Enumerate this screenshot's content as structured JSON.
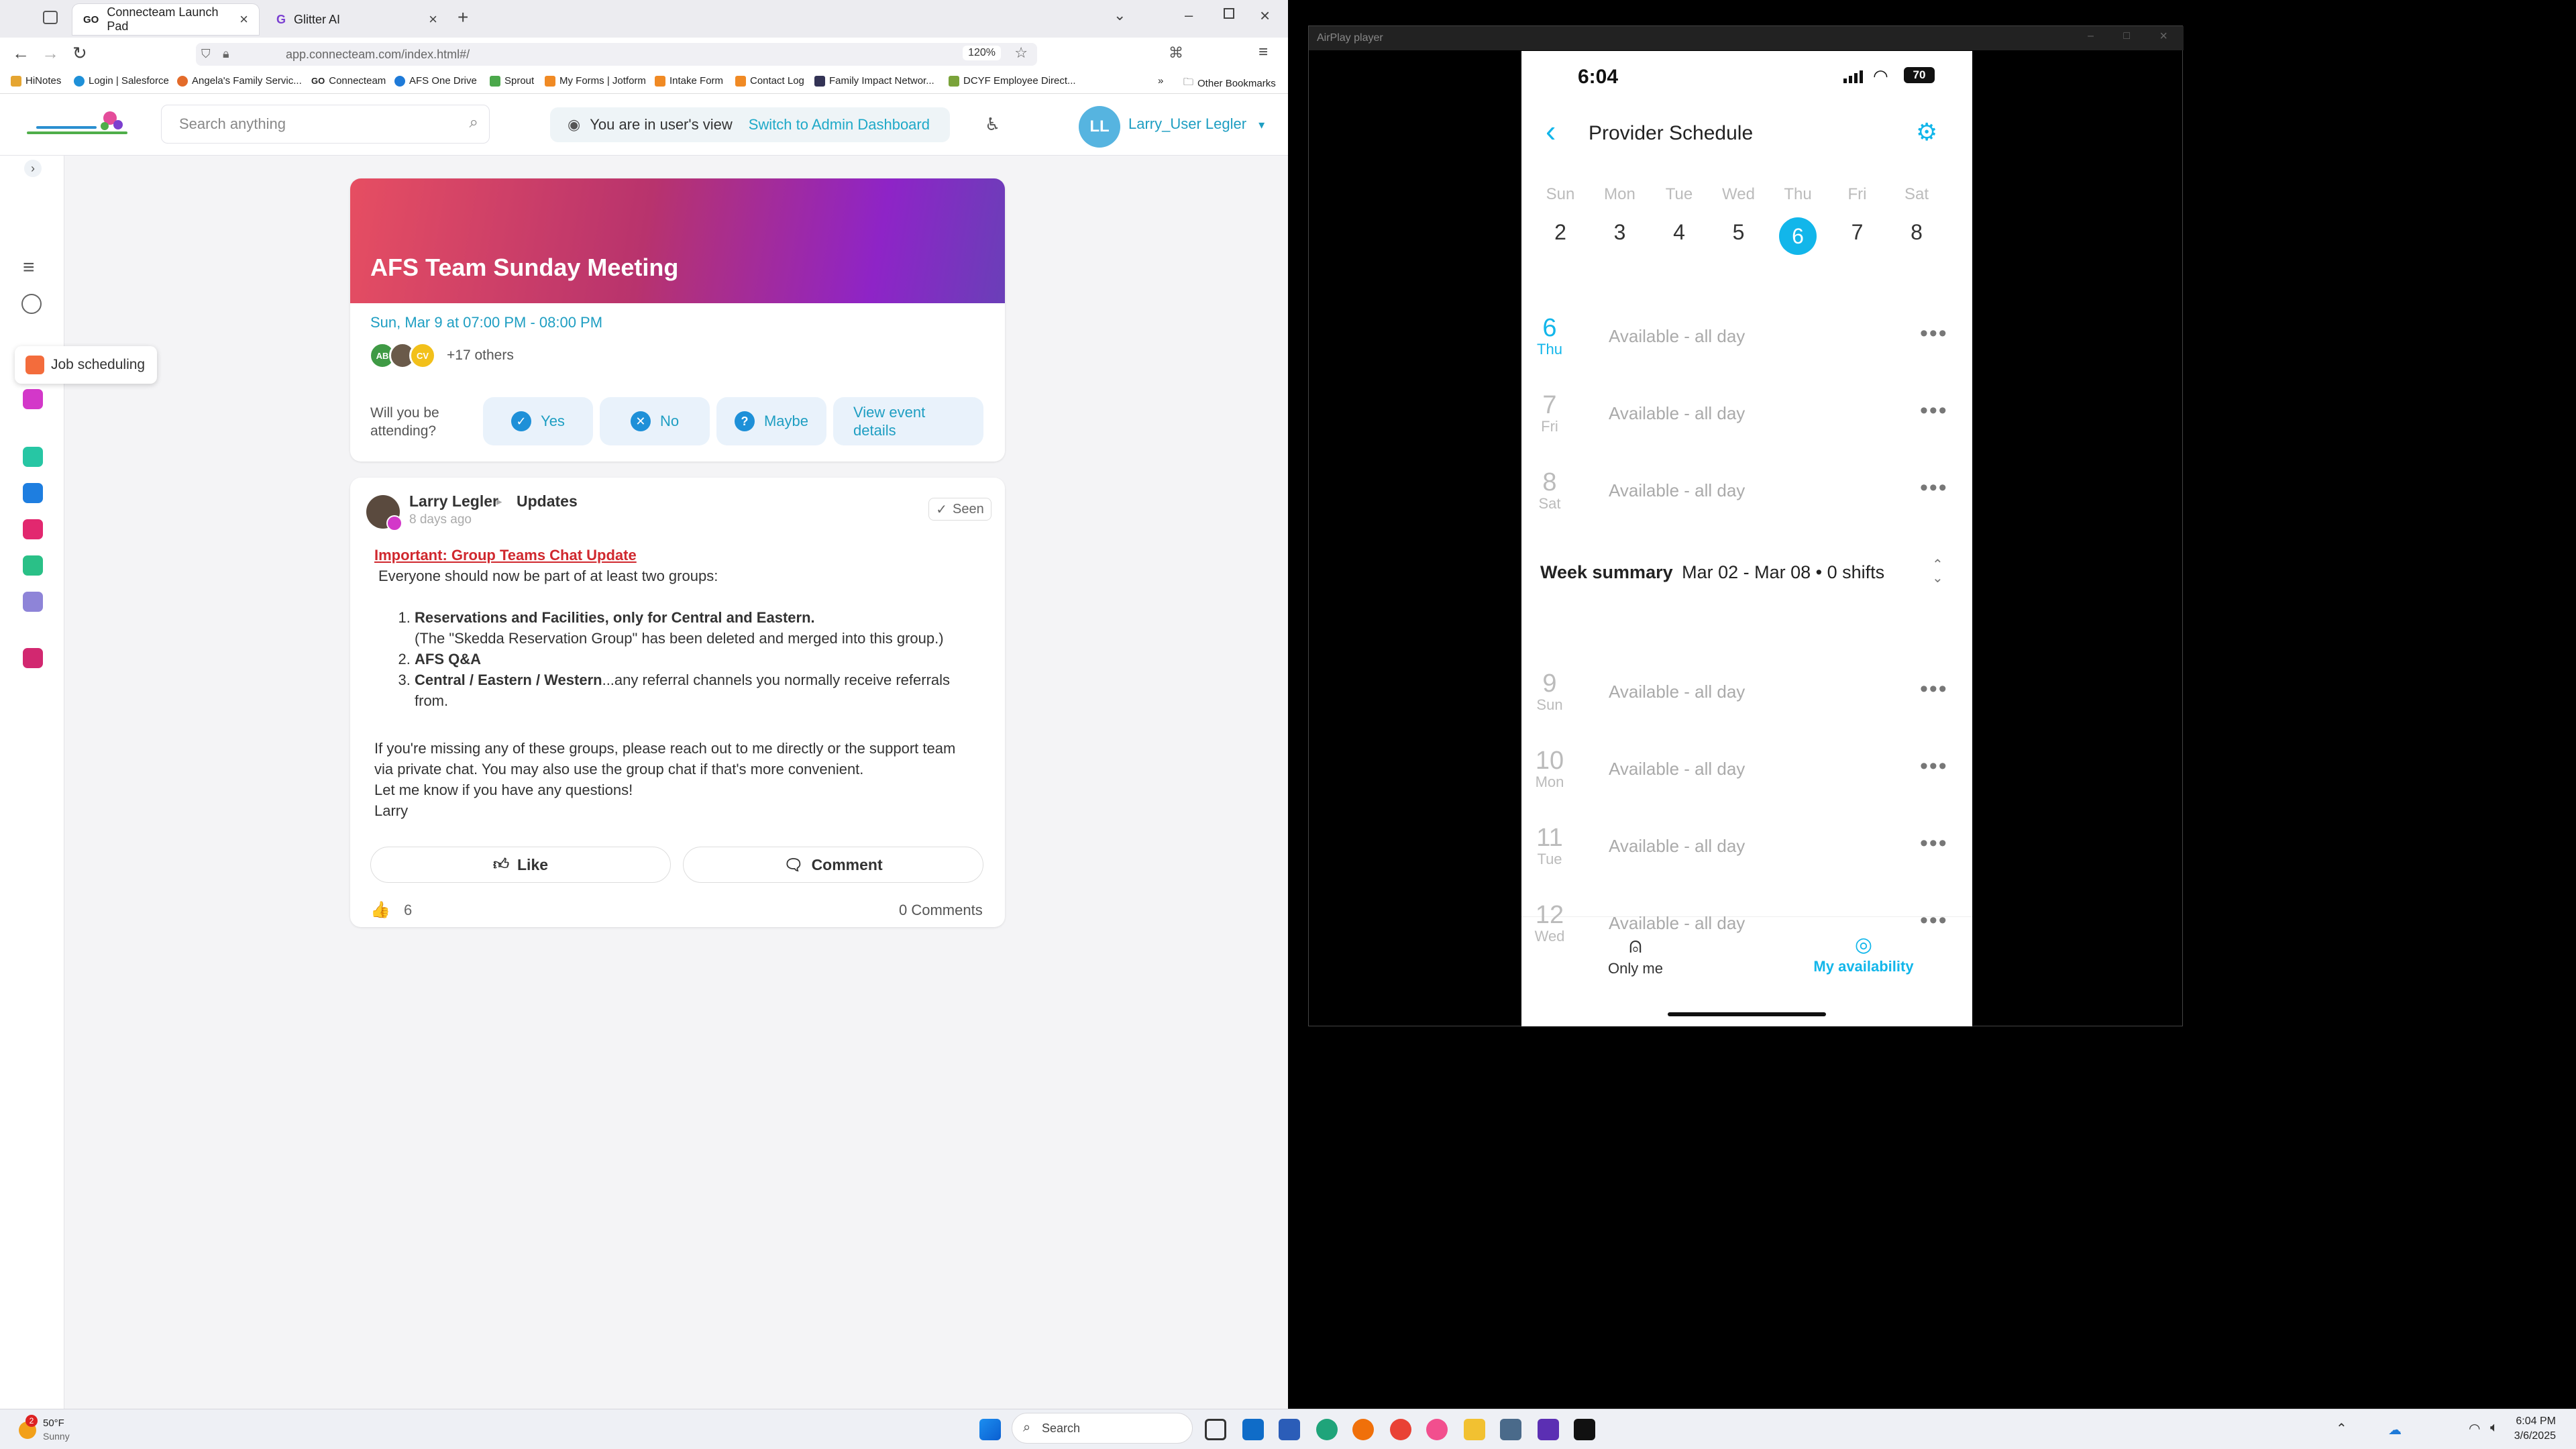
{
  "browser": {
    "tabs": [
      {
        "label": "Connecteam Launch Pad",
        "active": true
      },
      {
        "label": "Glitter AI",
        "active": false
      }
    ],
    "url": "app.connecteam.com/index.html#/",
    "zoom": "120%",
    "bookmarks": [
      "HiNotes",
      "Login | Salesforce",
      "Angela's Family Servic...",
      "Connecteam",
      "AFS One Drive",
      "Sprout",
      "My Forms | Jotform",
      "Intake Form",
      "Contact Log",
      "Family Impact Networ...",
      "DCYF Employee Direct..."
    ],
    "other_bookmarks": "Other Bookmarks"
  },
  "app": {
    "search_placeholder": "Search anything",
    "user_view_text": "You are in user's view",
    "switch_link": "Switch to Admin Dashboard",
    "avatar_initials": "LL",
    "username": "Larry_User Legler",
    "tooltip": "Job scheduling"
  },
  "event": {
    "title": "AFS Team Sunday Meeting",
    "date": "Sun, Mar 9 at 07:00 PM - 08:00 PM",
    "avatars": [
      "AB",
      "",
      "CV"
    ],
    "others": "+17 others",
    "question": "Will you be attending?",
    "yes": "Yes",
    "no": "No",
    "maybe": "Maybe",
    "view_details": "View event details"
  },
  "post": {
    "author": "Larry Legler",
    "group": "Updates",
    "when": "8 days ago",
    "seen": "Seen",
    "headline": "Important: Group Teams Chat Update",
    "intro": "Everyone should now be part of at least two groups:",
    "item1_bold": "Reservations and Facilities, only for Central and Eastern.",
    "item1_note": "(The \"Skedda Reservation Group\" has been deleted and merged into this group.)",
    "item2_bold": "AFS Q&A",
    "item3_bold": "Central / Eastern / Western",
    "item3_rest": "...any referral channels you normally receive referrals from.",
    "para1": "If you're missing any of these groups, please reach out to me directly or the support team via private chat. You may also use the group chat if that's more convenient.",
    "para2": "Let me know if you have any questions!",
    "signoff": "Larry",
    "like_label": "Like",
    "comment_label": "Comment",
    "like_count": "6",
    "comment_count": "0 Comments"
  },
  "taskbar": {
    "weather_temp": "50°F",
    "weather_desc": "Sunny",
    "weather_badge": "2",
    "search": "Search",
    "time": "6:04 PM",
    "date": "3/6/2025"
  },
  "airplay": {
    "window_title": "AirPlay player",
    "status_time": "6:04",
    "battery": "70",
    "screen_title": "Provider Schedule",
    "week_days": [
      "Sun",
      "Mon",
      "Tue",
      "Wed",
      "Thu",
      "Fri",
      "Sat"
    ],
    "week_nums": [
      "2",
      "3",
      "4",
      "5",
      "6",
      "7",
      "8"
    ],
    "selected_index": 4,
    "rows_a": [
      {
        "num": "6",
        "day": "Thu",
        "text": "Available -  all day",
        "today": true
      },
      {
        "num": "7",
        "day": "Fri",
        "text": "Available -  all day"
      },
      {
        "num": "8",
        "day": "Sat",
        "text": "Available -  all day"
      }
    ],
    "summary_bold": "Week summary",
    "summary_rest": "Mar 02 - Mar 08 • 0 shifts",
    "rows_b": [
      {
        "num": "9",
        "day": "Sun",
        "text": "Available -  all day"
      },
      {
        "num": "10",
        "day": "Mon",
        "text": "Available -  all day"
      },
      {
        "num": "11",
        "day": "Tue",
        "text": "Available -  all day"
      },
      {
        "num": "12",
        "day": "Wed",
        "text": "Available -  all day"
      }
    ],
    "nav_only_me": "Only me",
    "nav_availability": "My availability"
  },
  "colors": {
    "accent": "#1e9ec2",
    "event_gradient_start": "#e64e62",
    "event_gradient_end": "#8e24c7",
    "important_red": "#d0282e",
    "phone_selected": "#12b6ea"
  }
}
